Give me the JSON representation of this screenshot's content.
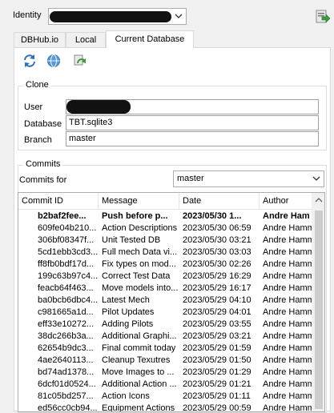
{
  "identity": {
    "label": "Identity"
  },
  "tabs": [
    {
      "label": "DBHub.io"
    },
    {
      "label": "Local"
    },
    {
      "label": "Current Database"
    }
  ],
  "clone": {
    "title": "Clone",
    "user_label": "User",
    "database_label": "Database",
    "database_value": "TBT.sqlite3",
    "branch_label": "Branch",
    "branch_value": "master"
  },
  "commits": {
    "title": "Commits",
    "for_label": "Commits for",
    "branch_value": "master",
    "columns": [
      "Commit ID",
      "Message",
      "Date",
      "Author"
    ],
    "rows": [
      {
        "id": "b2baf2fee...",
        "msg": "Push before p...",
        "date": "2023/05/30 1...",
        "author": "Andre Ham",
        "bold": true
      },
      {
        "id": "609fe04b210...",
        "msg": "Action Descriptions",
        "date": "2023/05/30 06:59",
        "author": "Andre Hamm"
      },
      {
        "id": "306bf08347f...",
        "msg": "Unit Tested DB",
        "date": "2023/05/30 03:21",
        "author": "Andre Hamm"
      },
      {
        "id": "5cd1ebb3cd3...",
        "msg": "Full mech Data vi...",
        "date": "2023/05/30 03:03",
        "author": "Andre Hamm"
      },
      {
        "id": "ff8fb0bdf17d...",
        "msg": "Fix types on mod...",
        "date": "2023/05/30 02:26",
        "author": "Andre Hamm"
      },
      {
        "id": "199c63b97c4...",
        "msg": "Correct Test Data",
        "date": "2023/05/29 16:29",
        "author": "Andre Hamm"
      },
      {
        "id": "feacb64f463...",
        "msg": "Move models into...",
        "date": "2023/05/29 16:17",
        "author": "Andre Hamm"
      },
      {
        "id": "ba0bcb6dbc4...",
        "msg": "Latest Mech",
        "date": "2023/05/29 04:10",
        "author": "Andre Hamm"
      },
      {
        "id": "c981665a1d...",
        "msg": "Pilot Updates",
        "date": "2023/05/29 04:01",
        "author": "Andre Hamm"
      },
      {
        "id": "eff33e10272...",
        "msg": "Adding Pilots",
        "date": "2023/05/29 03:55",
        "author": "Andre Hamm"
      },
      {
        "id": "38dc266b3a...",
        "msg": "Additional Graphi...",
        "date": "2023/05/29 03:21",
        "author": "Andre Hamm"
      },
      {
        "id": "62654b9dc3...",
        "msg": "Final commit today",
        "date": "2023/05/29 01:59",
        "author": "Andre Hamm"
      },
      {
        "id": "4ae2640113...",
        "msg": "Cleanup Texutres",
        "date": "2023/05/29 01:50",
        "author": "Andre Hamm"
      },
      {
        "id": "bd74ad1378...",
        "msg": "Move Images to ...",
        "date": "2023/05/29 01:29",
        "author": "Andre Hamm"
      },
      {
        "id": "6dcf01d0524...",
        "msg": "Additional Action ...",
        "date": "2023/05/29 01:21",
        "author": "Andre Hamm"
      },
      {
        "id": "81c05bd257...",
        "msg": "Action Icons",
        "date": "2023/05/29 01:11",
        "author": "Andre Hamm"
      },
      {
        "id": "ed56cc0cb94...",
        "msg": "Equipment Actions",
        "date": "2023/05/29 00:59",
        "author": "Andre Hamm"
      }
    ]
  },
  "colors": {
    "panel_bg": "#f0f0f0",
    "content_bg": "#ffffff",
    "border": "#adadad",
    "icon_blue": "#2f6fb5",
    "icon_green": "#3d9a3d"
  },
  "icons": {
    "export": "export-icon",
    "refresh": "refresh-icon",
    "web": "globe-icon",
    "sync": "sync-icon"
  }
}
